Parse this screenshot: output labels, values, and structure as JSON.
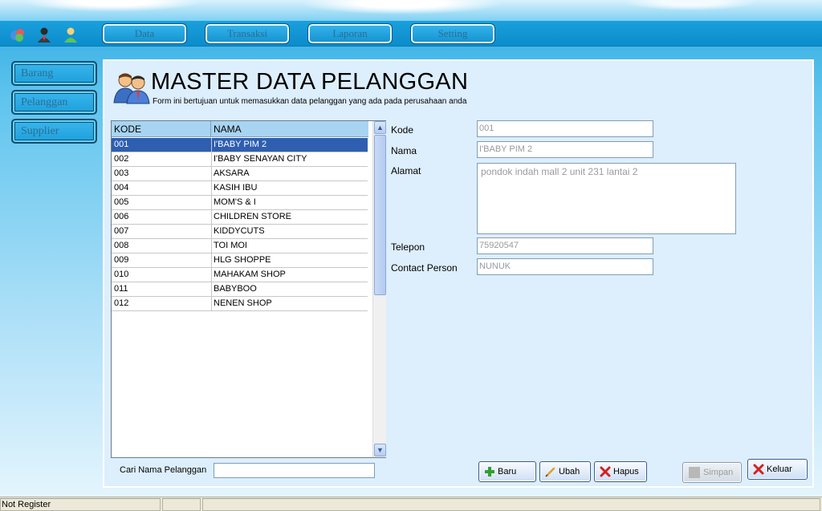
{
  "menu": {
    "items": [
      "Data",
      "Transaksi",
      "Laporan",
      "Setting"
    ],
    "icons": [
      "app-logo-icon",
      "user-dark-icon",
      "user-green-icon"
    ]
  },
  "sidebar": {
    "items": [
      "Barang",
      "Pelanggan",
      "Supplier"
    ]
  },
  "header": {
    "title": "MASTER DATA PELANGGAN",
    "subtitle": "Form ini bertujuan untuk memasukkan data pelanggan yang ada pada perusahaan anda"
  },
  "grid": {
    "columns": [
      "KODE",
      "NAMA"
    ],
    "rows": [
      [
        "001",
        "I'BABY PIM 2"
      ],
      [
        "002",
        "I'BABY SENAYAN CITY"
      ],
      [
        "003",
        "AKSARA"
      ],
      [
        "004",
        "KASIH IBU"
      ],
      [
        "005",
        "MOM'S & I"
      ],
      [
        "006",
        "CHILDREN STORE"
      ],
      [
        "007",
        "KIDDYCUTS"
      ],
      [
        "008",
        "TOI MOI"
      ],
      [
        "009",
        "HLG SHOPPE"
      ],
      [
        "010",
        "MAHAKAM SHOP"
      ],
      [
        "011",
        "BABYBOO"
      ],
      [
        "012",
        "NENEN SHOP"
      ]
    ],
    "selected_row": 0
  },
  "search": {
    "label": "Cari Nama Pelanggan",
    "value": ""
  },
  "form": {
    "kode_label": "Kode",
    "kode_value": "001",
    "nama_label": "Nama",
    "nama_value": "I'BABY PIM 2",
    "alamat_label": "Alamat",
    "alamat_value": "pondok indah mall 2 unit 231 lantai 2",
    "telepon_label": "Telepon",
    "telepon_value": "75920547",
    "contact_label": "Contact Person",
    "contact_value": "NUNUK"
  },
  "buttons": {
    "baru": "Baru",
    "ubah": "Ubah",
    "hapus": "Hapus",
    "simpan": "Simpan",
    "keluar": "Keluar"
  },
  "status": {
    "text": "Not Register"
  },
  "colors": {
    "selected_row": "#2e5eb0",
    "header_row": "#a8d4f2",
    "panel": "#ddeefc",
    "menu_blue": "#1694d1"
  }
}
